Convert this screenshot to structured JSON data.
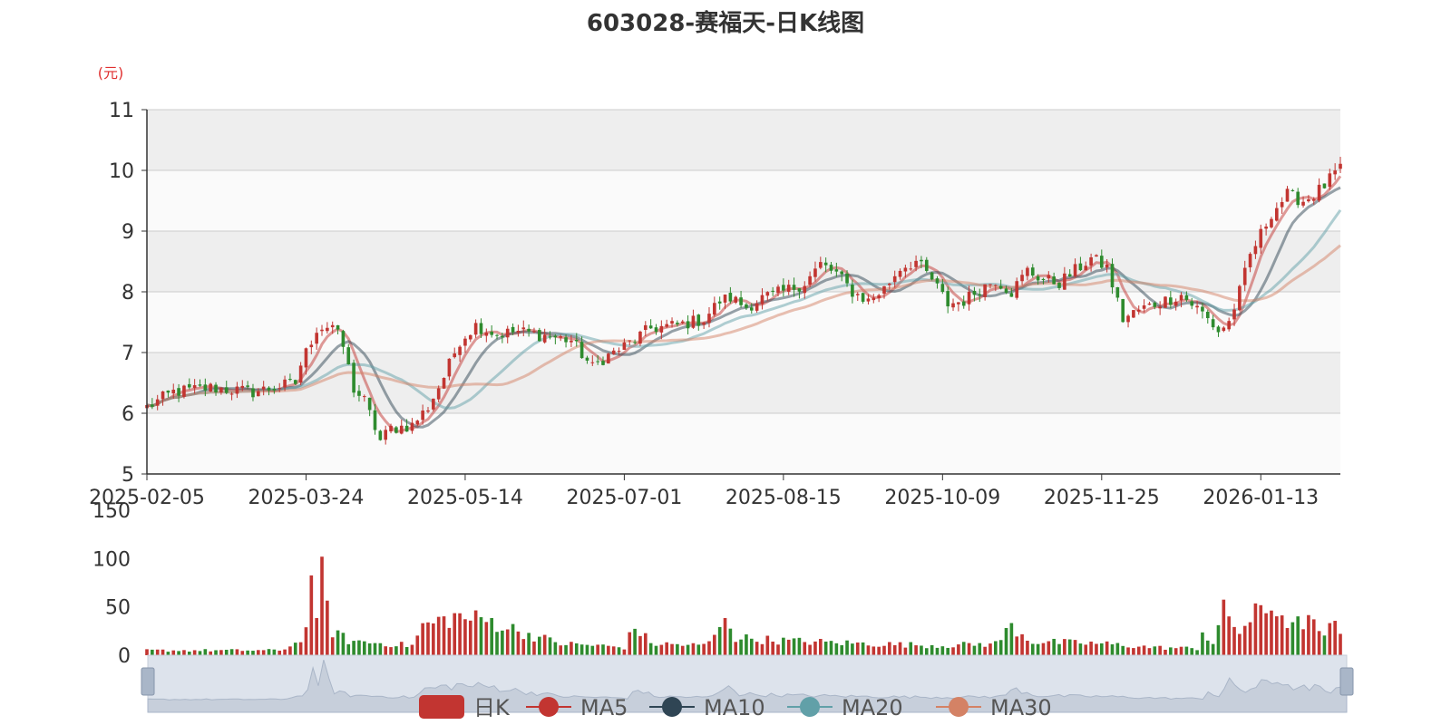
{
  "chart_data": {
    "type": "candlestick",
    "title": "603028-赛福天-日K线图",
    "ylabel": "(元)",
    "price_axis": {
      "ylim": [
        5,
        11
      ],
      "ticks": [
        5,
        6,
        7,
        8,
        9,
        10,
        11
      ]
    },
    "volume_axis": {
      "ylim": [
        0,
        150
      ],
      "ticks": [
        0,
        50,
        100,
        150
      ]
    },
    "x_tick_labels": [
      "2025-02-05",
      "2025-03-24",
      "2025-05-14",
      "2025-07-01",
      "2025-08-15",
      "2025-10-09",
      "2025-11-25",
      "2026-01-13"
    ],
    "x_tick_index": [
      0,
      30,
      60,
      90,
      120,
      150,
      180,
      210
    ],
    "legend": [
      {
        "name": "日K",
        "color": "#c23531"
      },
      {
        "name": "MA5",
        "color": "#c23531"
      },
      {
        "name": "MA10",
        "color": "#2f4554"
      },
      {
        "name": "MA20",
        "color": "#61a0a8"
      },
      {
        "name": "MA30",
        "color": "#d48265"
      }
    ],
    "grid": true,
    "colors": {
      "up": "#c23531",
      "down": "#2e8b2e",
      "zoom_fill": "#dde3ec",
      "zoom_line": "#aab6c8"
    },
    "anchors": [
      [
        0,
        6.1
      ],
      [
        5,
        6.35
      ],
      [
        12,
        6.42
      ],
      [
        20,
        6.35
      ],
      [
        28,
        6.5
      ],
      [
        29,
        6.8
      ],
      [
        31,
        7.2
      ],
      [
        32,
        7.4
      ],
      [
        35,
        7.45
      ],
      [
        37,
        7.1
      ],
      [
        39,
        6.4
      ],
      [
        41,
        6.2
      ],
      [
        44,
        5.55
      ],
      [
        46,
        5.75
      ],
      [
        50,
        5.8
      ],
      [
        53,
        6.1
      ],
      [
        56,
        6.6
      ],
      [
        59,
        7.2
      ],
      [
        62,
        7.45
      ],
      [
        66,
        7.3
      ],
      [
        70,
        7.35
      ],
      [
        75,
        7.28
      ],
      [
        80,
        7.2
      ],
      [
        84,
        6.75
      ],
      [
        86,
        6.9
      ],
      [
        90,
        7.1
      ],
      [
        95,
        7.4
      ],
      [
        100,
        7.45
      ],
      [
        105,
        7.55
      ],
      [
        108,
        7.85
      ],
      [
        110,
        7.9
      ],
      [
        113,
        7.75
      ],
      [
        116,
        7.9
      ],
      [
        120,
        8.0
      ],
      [
        124,
        8.15
      ],
      [
        127,
        8.45
      ],
      [
        130,
        8.3
      ],
      [
        133,
        8.0
      ],
      [
        136,
        7.85
      ],
      [
        139,
        8.05
      ],
      [
        142,
        8.4
      ],
      [
        145,
        8.5
      ],
      [
        148,
        8.2
      ],
      [
        151,
        7.8
      ],
      [
        154,
        7.85
      ],
      [
        157,
        8.05
      ],
      [
        160,
        8.2
      ],
      [
        163,
        8.0
      ],
      [
        166,
        8.35
      ],
      [
        169,
        8.2
      ],
      [
        172,
        8.15
      ],
      [
        175,
        8.35
      ],
      [
        178,
        8.55
      ],
      [
        181,
        8.4
      ],
      [
        184,
        7.55
      ],
      [
        187,
        7.7
      ],
      [
        190,
        7.8
      ],
      [
        195,
        7.95
      ],
      [
        199,
        7.65
      ],
      [
        202,
        7.35
      ],
      [
        204,
        7.5
      ],
      [
        206,
        8.0
      ],
      [
        208,
        8.6
      ],
      [
        210,
        8.95
      ],
      [
        212,
        9.3
      ],
      [
        215,
        9.6
      ],
      [
        218,
        9.5
      ],
      [
        220,
        9.6
      ],
      [
        222,
        9.75
      ],
      [
        224,
        9.95
      ],
      [
        225,
        10.0
      ]
    ],
    "volume_anchors": [
      [
        0,
        5
      ],
      [
        25,
        5
      ],
      [
        28,
        12
      ],
      [
        30,
        25
      ],
      [
        31,
        100
      ],
      [
        32,
        30
      ],
      [
        33,
        80
      ],
      [
        35,
        25
      ],
      [
        38,
        15
      ],
      [
        45,
        12
      ],
      [
        50,
        10
      ],
      [
        52,
        30
      ],
      [
        58,
        40
      ],
      [
        65,
        35
      ],
      [
        70,
        25
      ],
      [
        78,
        12
      ],
      [
        85,
        10
      ],
      [
        90,
        8
      ],
      [
        92,
        30
      ],
      [
        95,
        12
      ],
      [
        105,
        10
      ],
      [
        108,
        25
      ],
      [
        109,
        45
      ],
      [
        111,
        18
      ],
      [
        120,
        15
      ],
      [
        135,
        12
      ],
      [
        150,
        10
      ],
      [
        160,
        12
      ],
      [
        163,
        30
      ],
      [
        167,
        14
      ],
      [
        180,
        12
      ],
      [
        190,
        8
      ],
      [
        198,
        7
      ],
      [
        199,
        25
      ],
      [
        201,
        12
      ],
      [
        203,
        45
      ],
      [
        206,
        25
      ],
      [
        209,
        42
      ],
      [
        213,
        50
      ],
      [
        216,
        28
      ],
      [
        219,
        40
      ],
      [
        221,
        20
      ],
      [
        224,
        30
      ],
      [
        225,
        20
      ]
    ]
  }
}
